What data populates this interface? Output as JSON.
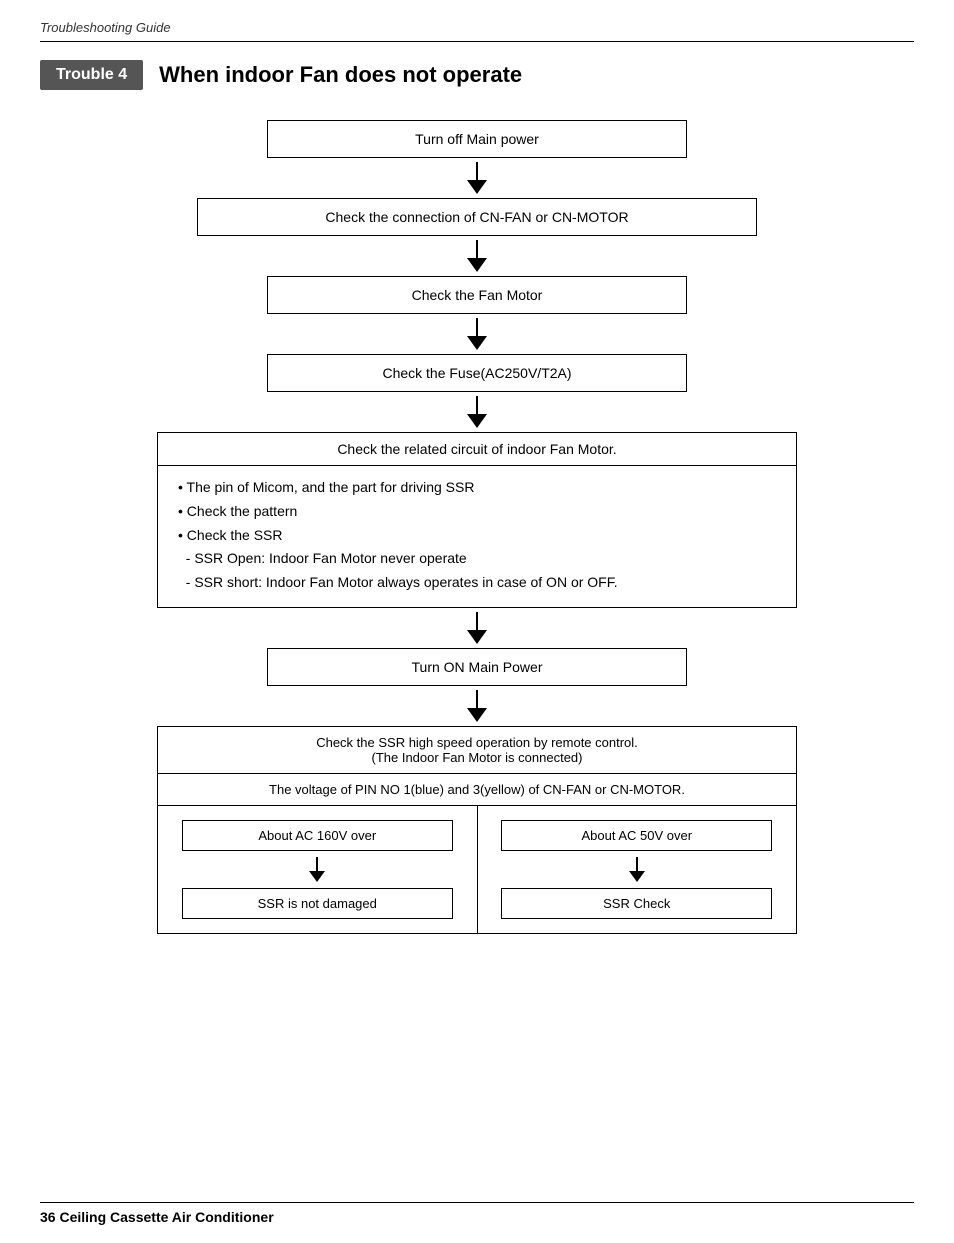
{
  "page": {
    "top_label": "Troubleshooting Guide",
    "footer_text": "36    Ceiling Cassette Air Conditioner"
  },
  "trouble": {
    "badge": "Trouble 4",
    "title": "When indoor Fan does not operate"
  },
  "flowchart": {
    "box1": "Turn off Main power",
    "box2": "Check the connection of CN-FAN or CN-MOTOR",
    "box3": "Check the Fan Motor",
    "box4": "Check the Fuse(AC250V/T2A)",
    "big_box_header": "Check the related circuit of indoor Fan Motor.",
    "big_box_lines": [
      "• The pin of Micom, and the part for driving SSR",
      "• Check the pattern",
      "• Check the SSR",
      "  - SSR Open: Indoor Fan Motor never operate",
      "  - SSR short: Indoor Fan Motor always operates in case of ON or OFF."
    ],
    "box_power_on": "Turn ON Main Power",
    "bottom_header": "Check the SSR high speed operation by remote control.\n(The Indoor Fan Motor is connected)",
    "bottom_voltage": "The voltage of PIN NO 1(blue) and 3(yellow) of CN-FAN or CN-MOTOR.",
    "col_left_label": "About AC 160V over",
    "col_left_result": "SSR is not damaged",
    "col_right_label": "About AC 50V over",
    "col_right_result": "SSR Check"
  }
}
